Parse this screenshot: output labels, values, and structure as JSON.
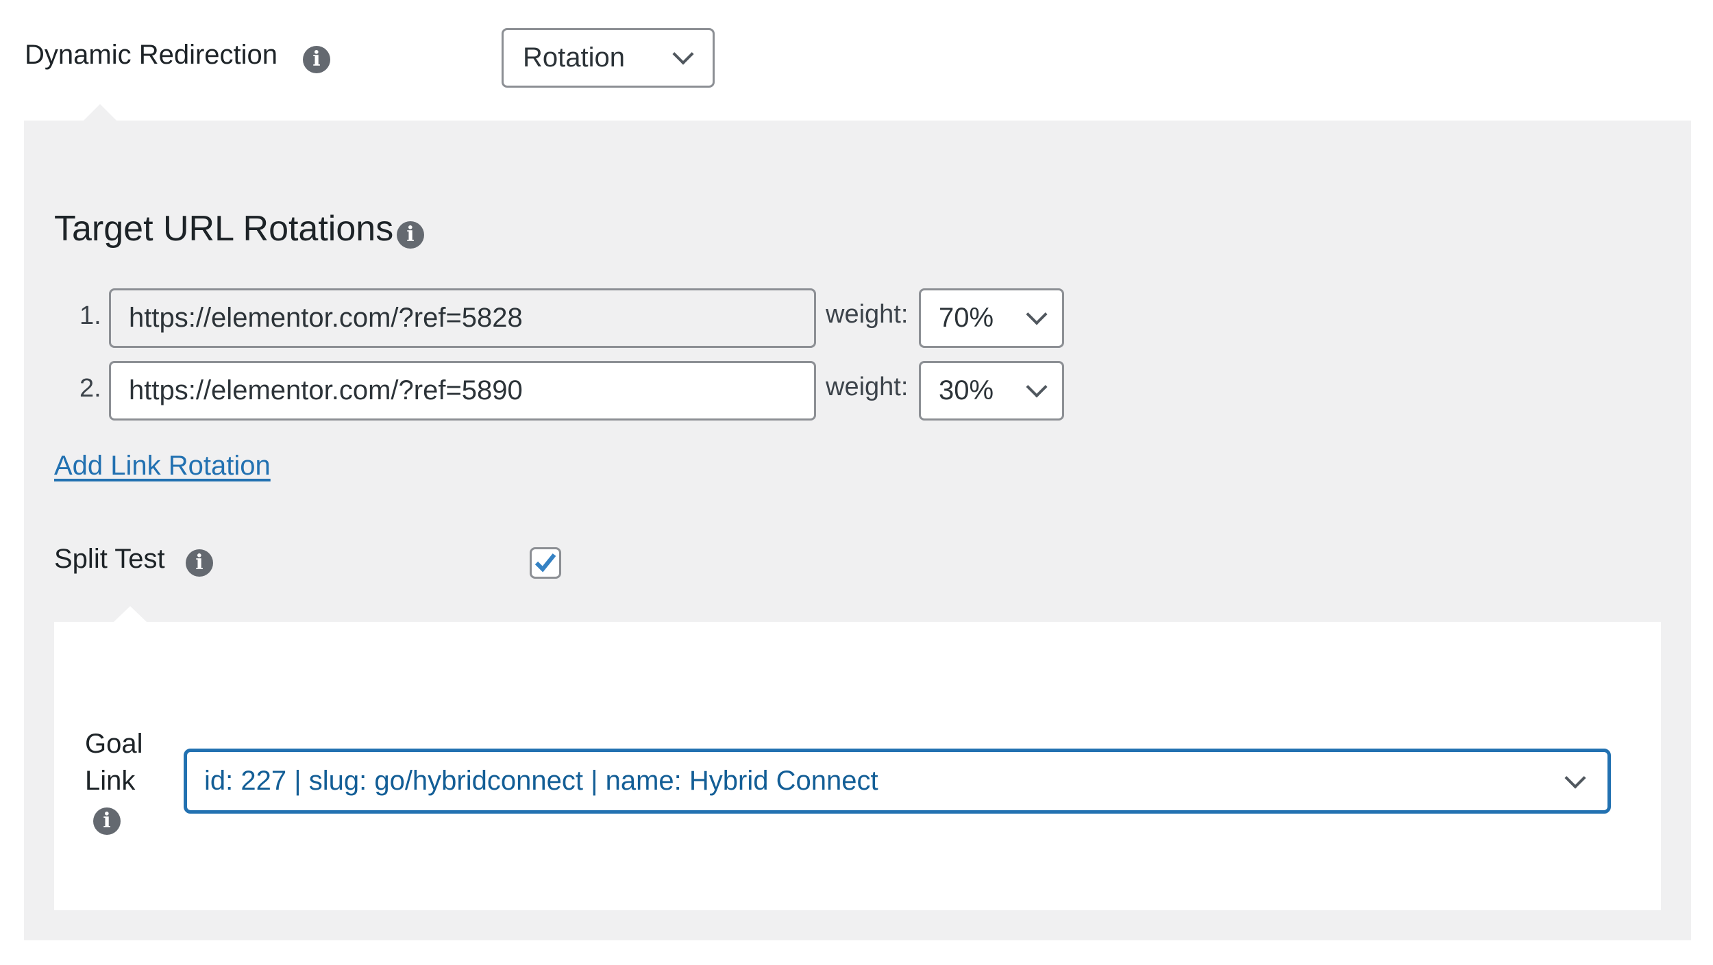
{
  "dynamic_redirection": {
    "label": "Dynamic Redirection",
    "info_icon": "info-icon",
    "select_value": "Rotation"
  },
  "target_url_rotations": {
    "heading": "Target URL Rotations",
    "info_icon": "info-icon",
    "weight_label": "weight:",
    "rows": [
      {
        "number": "1.",
        "url": "https://elementor.com/?ref=5828",
        "weight": "70%"
      },
      {
        "number": "2.",
        "url": "https://elementor.com/?ref=5890",
        "weight": "30%"
      }
    ],
    "add_link": "Add Link Rotation"
  },
  "split_test": {
    "label": "Split Test",
    "info_icon": "info-icon",
    "checked": true
  },
  "goal_link": {
    "label_line1": "Goal",
    "label_line2": "Link",
    "info_icon": "info-icon",
    "select_value": "id: 227 | slug: go/hybridconnect | name: Hybrid Connect"
  },
  "icons": {
    "info_glyph": "i"
  },
  "colors": {
    "panel_gray": "#f0f0f1",
    "link_blue": "#2271b1",
    "focus_blue": "#2271b1",
    "check_blue": "#3582c4",
    "info_gray": "#646970"
  }
}
